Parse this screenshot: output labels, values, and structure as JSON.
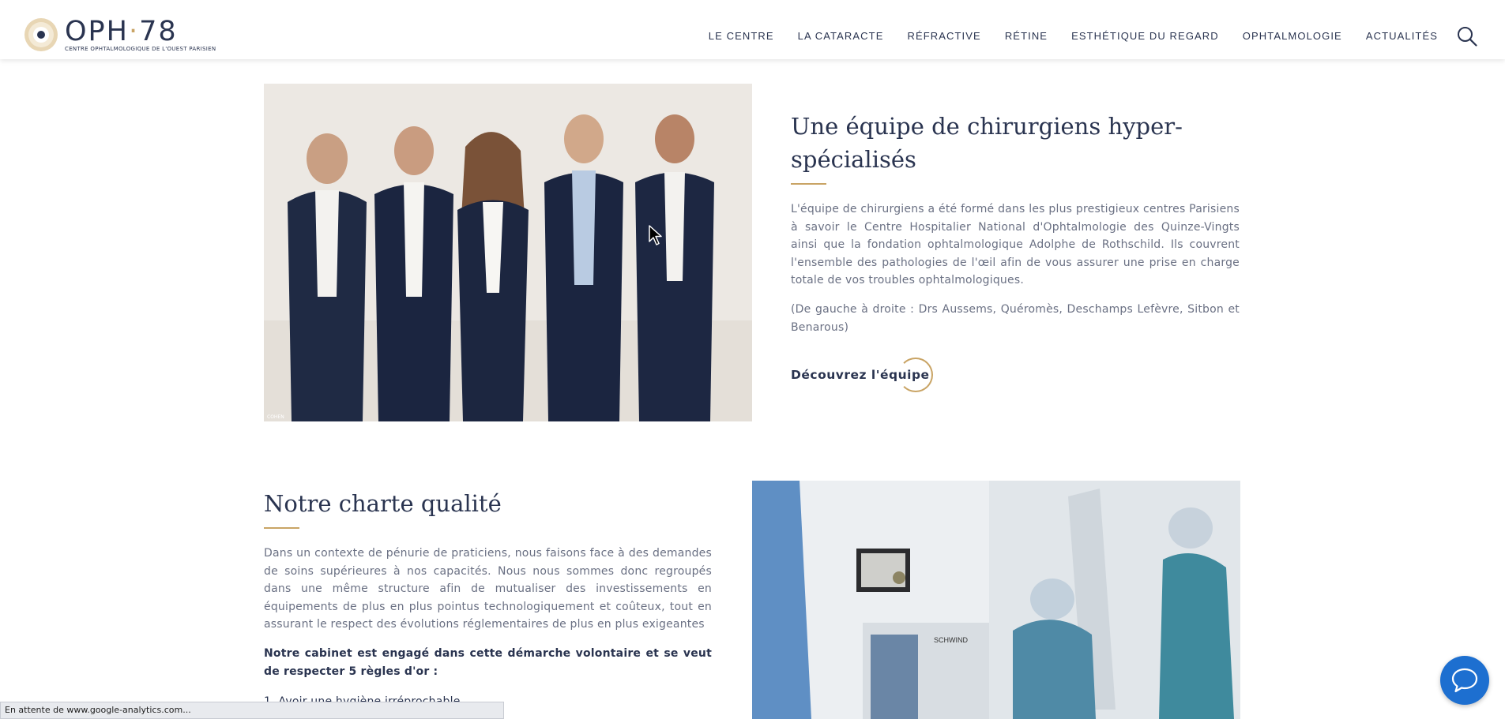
{
  "header": {
    "logo_text": "OPH",
    "logo_number": "78",
    "logo_dot": "·",
    "logo_subtitle": "CENTRE OPHTALMOLOGIQUE DE L'OUEST PARISIEN",
    "nav": [
      "LE CENTRE",
      "LA CATARACTE",
      "RÉFRACTIVE",
      "RÉTINE",
      "ESTHÉTIQUE DU REGARD",
      "OPHTALMOLOGIE",
      "ACTUALITÉS"
    ],
    "search_icon": "search-icon"
  },
  "team": {
    "title": "Une équipe de chirurgiens hyper-spécialisés",
    "paragraph": "L'équipe de chirurgiens a été formé dans les plus prestigieux centres Parisiens à savoir le Centre Hospitalier National d'Ophtalmologie des Quinze-Vingts ainsi que la fondation ophtalmologique Adolphe de Rothschild. Ils couvrent l'ensemble des pathologies de l'œil afin de vous assurer une prise en charge totale de vos troubles ophtalmologiques.",
    "caption": "(De gauche à droite : Drs Aussems, Quéromès, Deschamps Lefèvre, Sitbon et Benarous)",
    "cta": "Découvrez l'équipe",
    "photo_credit": "COHEN"
  },
  "quality": {
    "title": "Notre charte qualité",
    "paragraph": "Dans un contexte de pénurie de praticiens, nous faisons face à des demandes de soins supérieures à nos capacités. Nous nous sommes donc regroupés dans une même structure afin de mutualiser des investissements en équipements de plus en plus pointus technologiquement et coûteux, tout en assurant le respect des évolutions réglementaires de plus en plus exigeantes",
    "commitment": "Notre cabinet est engagé dans cette démarche volontaire et se veut de respecter 5 règles d'or :",
    "list_first": "1. Avoir une hygiène irréprochable",
    "equipment_label": "SCHWIND"
  },
  "chat": {
    "icon": "chat-bubble-icon"
  },
  "status_bar": "En attente de www.google-analytics.com...",
  "colors": {
    "navy": "#2a3450",
    "gold": "#c9a465",
    "text_gray": "#6a7083",
    "chat_blue": "#1d6fd0"
  }
}
